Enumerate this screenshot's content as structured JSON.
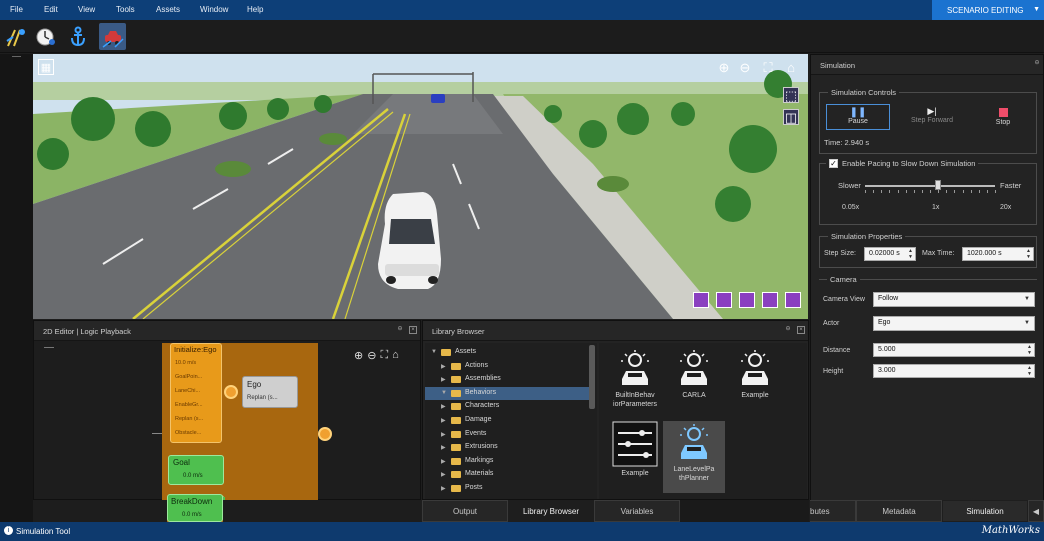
{
  "menubar": {
    "items": [
      "File",
      "Edit",
      "View",
      "Tools",
      "Assets",
      "Window",
      "Help"
    ],
    "mode": "SCENARIO EDITING"
  },
  "toolstrip": {
    "icons": [
      "road-tool-icon",
      "clock-tool-icon",
      "anchor-tool-icon",
      "vehicle-tool-icon"
    ]
  },
  "colors": {
    "accent": "#1b73d0",
    "menubar": "#0d3f78",
    "block_orange": "#e89a1a",
    "block_green": "#4fbf4f"
  },
  "simulation": {
    "panel_title": "Simulation",
    "controls": {
      "title": "Simulation Controls",
      "pause": "Pause",
      "step_forward": "Step Forward",
      "stop": "Stop",
      "time": "Time: 2.940 s"
    },
    "pacing": {
      "label": "Enable Pacing to Slow Down Simulation",
      "checked": true,
      "slower": "Slower",
      "faster": "Faster",
      "min": "0.05x",
      "mid": "1x",
      "max": "20x",
      "level": 0.56
    },
    "properties": {
      "title": "Simulation Properties",
      "step_size_label": "Step Size:",
      "step_size": "0.02000 s",
      "max_time_label": "Max Time:",
      "max_time": "1020.000 s"
    },
    "camera": {
      "title": "Camera",
      "view_label": "Camera View",
      "view": "Follow",
      "actor_label": "Actor",
      "actor": "Ego",
      "distance_label": "Distance",
      "distance": "5.000",
      "height_label": "Height",
      "height": "3.000"
    }
  },
  "editor": {
    "title": "2D Editor | Logic Playback",
    "blocks": {
      "init": {
        "title": "Initialize:Ego",
        "items": [
          "10.0 m/s",
          "GoalPoin...",
          "LaneChi...",
          "EnableGr...",
          "Replan (s...",
          "Obstacle..."
        ]
      },
      "ego": {
        "title": "Ego",
        "sub": "Replan (s..."
      },
      "goal": {
        "title": "Goal",
        "sub": "0.0 m/s"
      },
      "breakdown": {
        "title": "BreakDown",
        "sub": "0.0 m/s"
      }
    }
  },
  "library": {
    "title": "Library Browser",
    "tree": [
      {
        "label": "Assets",
        "expanded": true,
        "indent": 0
      },
      {
        "label": "Actions",
        "indent": 1
      },
      {
        "label": "Assemblies",
        "indent": 1
      },
      {
        "label": "Behaviors",
        "indent": 1,
        "selected": true,
        "expanded": true
      },
      {
        "label": "Characters",
        "indent": 1
      },
      {
        "label": "Damage",
        "indent": 1
      },
      {
        "label": "Events",
        "indent": 1
      },
      {
        "label": "Extrusions",
        "indent": 1
      },
      {
        "label": "Markings",
        "indent": 1
      },
      {
        "label": "Materials",
        "indent": 1
      },
      {
        "label": "Posts",
        "indent": 1
      }
    ],
    "assets": [
      {
        "label": "BuiltInBehav iorParameters",
        "icon": "behavior-car-icon"
      },
      {
        "label": "CARLA",
        "icon": "behavior-car-icon"
      },
      {
        "label": "Example",
        "icon": "behavior-car-icon"
      },
      {
        "label": "Example",
        "icon": "sliders-icon"
      },
      {
        "label": "LaneLevelPa thPlanner",
        "icon": "behavior-car-icon",
        "selected": true
      }
    ]
  },
  "bottom_tabs_left": [
    "Output",
    "Library Browser",
    "Variables"
  ],
  "bottom_tabs_right": [
    "butes",
    "Metadata",
    "Simulation"
  ],
  "status": {
    "text": "Simulation Tool",
    "brand": "MathWorks"
  }
}
